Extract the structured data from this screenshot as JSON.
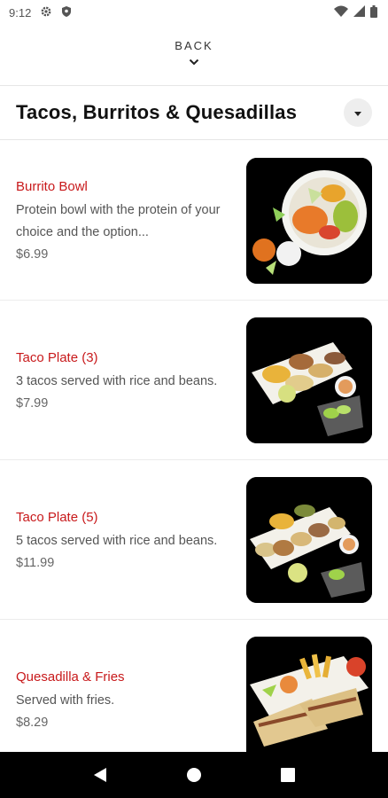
{
  "status_bar": {
    "time": "9:12",
    "left_icons": [
      "gear-icon",
      "shield-icon"
    ],
    "right_icons": [
      "wifi-icon",
      "signal-icon",
      "battery-icon"
    ]
  },
  "header": {
    "back_label": "BACK"
  },
  "category": {
    "title": "Tacos, Burritos & Quesadillas"
  },
  "menu_items": [
    {
      "name": "Burrito Bowl",
      "description": "Protein bowl with the protein of your choice and the option...",
      "price": "$6.99",
      "image": "burrito-bowl-photo"
    },
    {
      "name": "Taco Plate (3)",
      "description": "3 tacos served with rice and beans.",
      "price": "$7.99",
      "image": "taco-plate-3-photo"
    },
    {
      "name": "Taco Plate (5)",
      "description": "5 tacos served with rice and beans.",
      "price": "$11.99",
      "image": "taco-plate-5-photo"
    },
    {
      "name": "Quesadilla & Fries",
      "description": "Served with fries.",
      "price": "$8.29",
      "image": "quesadilla-fries-photo"
    }
  ],
  "nav_bar": {
    "buttons": [
      "back-triangle-icon",
      "home-circle-icon",
      "recents-square-icon"
    ]
  },
  "colors": {
    "item_name": "#c8191b",
    "photo_background": "#000000",
    "nav_bar": "#000000"
  }
}
